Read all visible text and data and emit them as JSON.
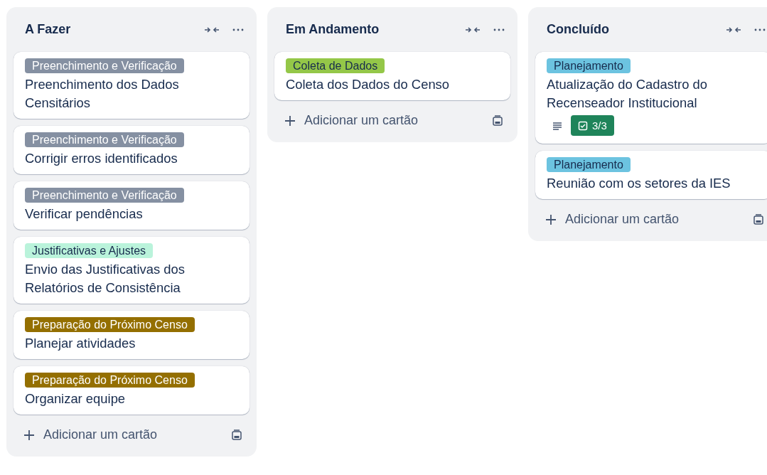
{
  "lists": [
    {
      "title": "A Fazer",
      "cards": [
        {
          "label": {
            "text": "Preenchimento e Verificação",
            "color": "#8590a2"
          },
          "title": "Preenchimento dos Dados Censitários"
        },
        {
          "label": {
            "text": "Preenchimento e Verificação",
            "color": "#8590a2"
          },
          "title": "Corrigir erros identificados"
        },
        {
          "label": {
            "text": "Preenchimento e Verificação",
            "color": "#8590a2"
          },
          "title": "Verificar pendências"
        },
        {
          "label": {
            "text": "Justificativas e Ajustes",
            "color": "#baf3db"
          },
          "title": "Envio das Justificativas dos Relatórios de Consistência"
        },
        {
          "label": {
            "text": "Preparação do Próximo Censo",
            "color": "#946f00"
          },
          "title": "Planejar atividades"
        },
        {
          "label": {
            "text": "Preparação do Próximo Censo",
            "color": "#946f00"
          },
          "title": "Organizar equipe"
        }
      ],
      "add_label": "Adicionar um cartão"
    },
    {
      "title": "Em Andamento",
      "cards": [
        {
          "label": {
            "text": "Coleta de Dados",
            "color": "#94c748"
          },
          "title": "Coleta dos Dados do Censo"
        }
      ],
      "add_label": "Adicionar um cartão"
    },
    {
      "title": "Concluído",
      "cards": [
        {
          "label": {
            "text": "Planejamento",
            "color": "#6cc3e0"
          },
          "title": "Atualização do Cadastro do Recenseador Institucional",
          "has_description": true,
          "checklist": {
            "text": "3/3",
            "complete": true
          }
        },
        {
          "label": {
            "text": "Planejamento",
            "color": "#6cc3e0"
          },
          "title": "Reunião com os setores da IES"
        }
      ],
      "add_label": "Adicionar um cartão"
    }
  ]
}
